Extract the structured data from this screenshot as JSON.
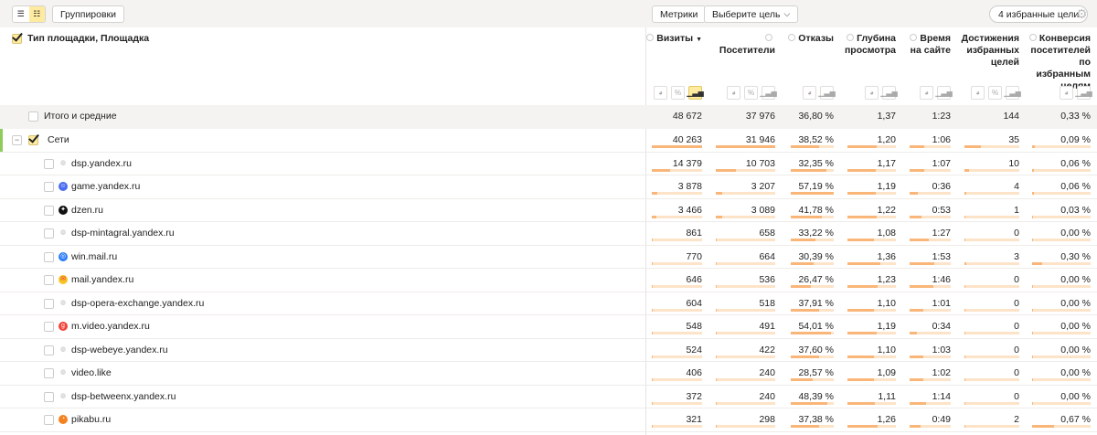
{
  "toolbar": {
    "groupings": "Группировки",
    "metrics": "Метрики",
    "goal_select": "Выберите цель",
    "favorite_goals": "4 избранные цели"
  },
  "header": {
    "dimension_title": "Тип площадки, Площадка",
    "metrics": [
      {
        "label": "Визиты",
        "sorted": "▼",
        "icons": [
          "pie",
          "%",
          "bar"
        ],
        "active": "bar"
      },
      {
        "label": "Посетители",
        "icons": [
          "pie",
          "%",
          "bar"
        ]
      },
      {
        "label": "Отказы",
        "icons": [
          "pie",
          "bar"
        ]
      },
      {
        "label": "Глубина просмотра",
        "icons": [
          "pie",
          "bar"
        ]
      },
      {
        "label": "Время на сайте",
        "icons": [
          "pie",
          "bar"
        ]
      },
      {
        "label": "Достижения избранных целей",
        "icons": [
          "pie",
          "%",
          "bar"
        ]
      },
      {
        "label": "Конверсия посетителей по избранным целям",
        "icons": [
          "pie",
          "bar"
        ]
      }
    ]
  },
  "total": {
    "label": "Итого и средние",
    "values": [
      "48 672",
      "37 976",
      "36,80 %",
      "1,37",
      "1:23",
      "144",
      "0,33 %"
    ]
  },
  "group": {
    "label": "Сети",
    "values": [
      "40 263",
      "31 946",
      "38,52 %",
      "1,20",
      "1:06",
      "35",
      "0,09 %"
    ],
    "bars": [
      1,
      1,
      0.67,
      0.6,
      0.35,
      0.3,
      0.05
    ]
  },
  "rows": [
    {
      "name": "dsp.yandex.ru",
      "icon": "globe",
      "values": [
        "14 379",
        "10 703",
        "32,35 %",
        "1,17",
        "1:07",
        "10",
        "0,06 %"
      ],
      "bars": [
        0.36,
        0.34,
        0.83,
        0.58,
        0.36,
        0.09,
        0.03
      ]
    },
    {
      "name": "game.yandex.ru",
      "icon": "game",
      "values": [
        "3 878",
        "3 207",
        "57,19 %",
        "1,19",
        "0:36",
        "4",
        "0,06 %"
      ],
      "bars": [
        0.1,
        0.1,
        1,
        0.59,
        0.2,
        0.04,
        0.03
      ]
    },
    {
      "name": "dzen.ru",
      "icon": "dzen",
      "values": [
        "3 466",
        "3 089",
        "41,78 %",
        "1,22",
        "0:53",
        "1",
        "0,03 %"
      ],
      "bars": [
        0.09,
        0.1,
        0.73,
        0.61,
        0.29,
        0.01,
        0.02
      ]
    },
    {
      "name": "dsp-mintagral.yandex.ru",
      "icon": "globe",
      "values": [
        "861",
        "658",
        "33,22 %",
        "1,08",
        "1:27",
        "0",
        "0,00 %"
      ],
      "bars": [
        0.02,
        0.02,
        0.58,
        0.54,
        0.47,
        0,
        0
      ]
    },
    {
      "name": "win.mail.ru",
      "icon": "winmail",
      "values": [
        "770",
        "664",
        "30,39 %",
        "1,36",
        "1:53",
        "3",
        "0,30 %"
      ],
      "bars": [
        0.02,
        0.02,
        0.53,
        0.68,
        0.61,
        0.03,
        0.17
      ]
    },
    {
      "name": "mail.yandex.ru",
      "icon": "mail",
      "values": [
        "646",
        "536",
        "26,47 %",
        "1,23",
        "1:46",
        "0",
        "0,00 %"
      ],
      "bars": [
        0.02,
        0.02,
        0.46,
        0.62,
        0.57,
        0,
        0
      ]
    },
    {
      "name": "dsp-opera-exchange.yandex.ru",
      "icon": "globe",
      "values": [
        "604",
        "518",
        "37,91 %",
        "1,10",
        "1:01",
        "0",
        "0,00 %"
      ],
      "bars": [
        0.02,
        0.02,
        0.66,
        0.55,
        0.33,
        0,
        0
      ]
    },
    {
      "name": "m.video.yandex.ru",
      "icon": "video",
      "values": [
        "548",
        "491",
        "54,01 %",
        "1,19",
        "0:34",
        "0",
        "0,00 %"
      ],
      "bars": [
        0.01,
        0.02,
        0.94,
        0.6,
        0.18,
        0,
        0
      ]
    },
    {
      "name": "dsp-webeye.yandex.ru",
      "icon": "globe",
      "values": [
        "524",
        "422",
        "37,60 %",
        "1,10",
        "1:03",
        "0",
        "0,00 %"
      ],
      "bars": [
        0.01,
        0.01,
        0.66,
        0.55,
        0.34,
        0,
        0
      ]
    },
    {
      "name": "video.like",
      "icon": "globe",
      "values": [
        "406",
        "240",
        "28,57 %",
        "1,09",
        "1:02",
        "0",
        "0,00 %"
      ],
      "bars": [
        0.01,
        0.01,
        0.5,
        0.55,
        0.33,
        0,
        0
      ]
    },
    {
      "name": "dsp-betweenx.yandex.ru",
      "icon": "globe",
      "values": [
        "372",
        "240",
        "48,39 %",
        "1,11",
        "1:14",
        "0",
        "0,00 %"
      ],
      "bars": [
        0.01,
        0.01,
        0.85,
        0.56,
        0.4,
        0,
        0
      ]
    },
    {
      "name": "pikabu.ru",
      "icon": "pikabu",
      "values": [
        "321",
        "298",
        "37,38 %",
        "1,26",
        "0:49",
        "2",
        "0,67 %"
      ],
      "bars": [
        0.01,
        0.01,
        0.65,
        0.63,
        0.26,
        0.02,
        0.38
      ]
    }
  ],
  "colors": {
    "accent": "#ffeba0",
    "bar": "#f9b678",
    "bar_bg": "#fde3c8",
    "group_marker": "#8fcc5c"
  }
}
